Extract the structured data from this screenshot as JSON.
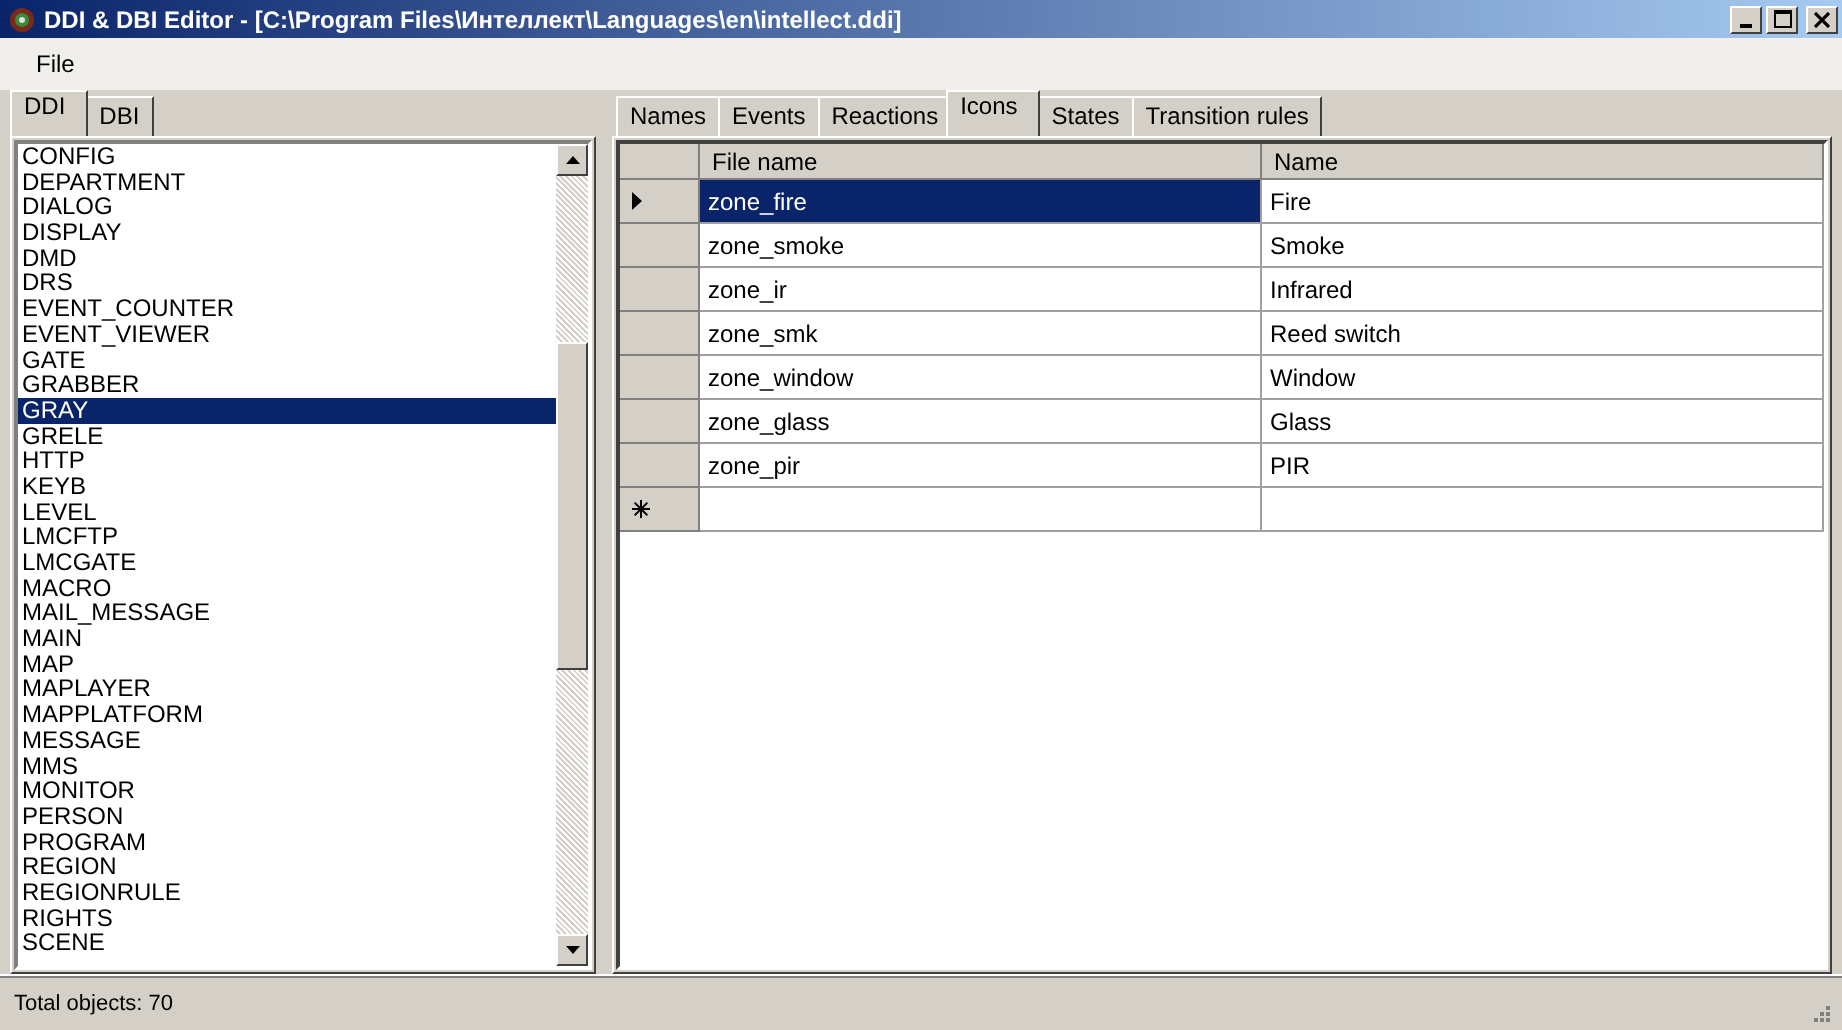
{
  "window": {
    "title": "DDI & DBI Editor - [C:\\Program Files\\Интеллект\\Languages\\en\\intellect.ddi]"
  },
  "menu": [
    "File"
  ],
  "left_tabs": [
    {
      "label": "DDI",
      "selected": true
    },
    {
      "label": "DBI",
      "selected": false
    }
  ],
  "objects": [
    {
      "label": "CONFIG",
      "selected": false
    },
    {
      "label": "DEPARTMENT",
      "selected": false
    },
    {
      "label": "DIALOG",
      "selected": false
    },
    {
      "label": "DISPLAY",
      "selected": false
    },
    {
      "label": "DMD",
      "selected": false
    },
    {
      "label": "DRS",
      "selected": false
    },
    {
      "label": "EVENT_COUNTER",
      "selected": false
    },
    {
      "label": "EVENT_VIEWER",
      "selected": false
    },
    {
      "label": "GATE",
      "selected": false
    },
    {
      "label": "GRABBER",
      "selected": false
    },
    {
      "label": "GRAY",
      "selected": true
    },
    {
      "label": "GRELE",
      "selected": false
    },
    {
      "label": "HTTP",
      "selected": false
    },
    {
      "label": "KEYB",
      "selected": false
    },
    {
      "label": "LEVEL",
      "selected": false
    },
    {
      "label": "LMCFTP",
      "selected": false
    },
    {
      "label": "LMCGATE",
      "selected": false
    },
    {
      "label": "MACRO",
      "selected": false
    },
    {
      "label": "MAIL_MESSAGE",
      "selected": false
    },
    {
      "label": "MAIN",
      "selected": false
    },
    {
      "label": "MAP",
      "selected": false
    },
    {
      "label": "MAPLAYER",
      "selected": false
    },
    {
      "label": "MAPPLATFORM",
      "selected": false
    },
    {
      "label": "MESSAGE",
      "selected": false
    },
    {
      "label": "MMS",
      "selected": false
    },
    {
      "label": "MONITOR",
      "selected": false
    },
    {
      "label": "PERSON",
      "selected": false
    },
    {
      "label": "PROGRAM",
      "selected": false
    },
    {
      "label": "REGION",
      "selected": false
    },
    {
      "label": "REGIONRULE",
      "selected": false
    },
    {
      "label": "RIGHTS",
      "selected": false
    },
    {
      "label": "SCENE",
      "selected": false
    }
  ],
  "right_tabs": [
    {
      "label": "Names",
      "selected": false
    },
    {
      "label": "Events",
      "selected": false
    },
    {
      "label": "Reactions",
      "selected": false
    },
    {
      "label": "Icons",
      "selected": true
    },
    {
      "label": "States",
      "selected": false
    },
    {
      "label": "Transition rules",
      "selected": false
    }
  ],
  "table": {
    "columns": [
      "File name",
      "Name"
    ],
    "rows": [
      {
        "file_name": "zone_fire",
        "name": "Fire",
        "selected": true
      },
      {
        "file_name": "zone_smoke",
        "name": "Smoke",
        "selected": false
      },
      {
        "file_name": "zone_ir",
        "name": "Infrared",
        "selected": false
      },
      {
        "file_name": "zone_smk",
        "name": "Reed switch",
        "selected": false
      },
      {
        "file_name": "zone_window",
        "name": "Window",
        "selected": false
      },
      {
        "file_name": "zone_glass",
        "name": "Glass",
        "selected": false
      },
      {
        "file_name": "zone_pir",
        "name": "PIR",
        "selected": false
      }
    ],
    "new_row": true
  },
  "status_bar": "Total objects: 70"
}
